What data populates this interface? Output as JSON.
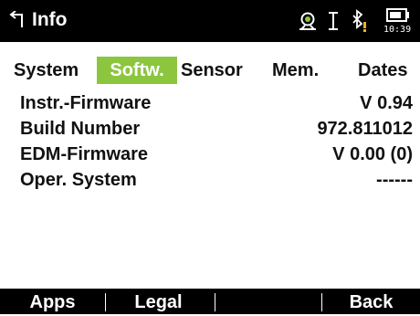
{
  "titlebar": {
    "title": "Info",
    "icons": [
      "back-arrow-icon",
      "target-camera-icon",
      "cursor-icon",
      "bluetooth-warning-icon",
      "battery-icon"
    ],
    "clock": "10:39",
    "accent_color": "#8cc63f",
    "warning_color": "#f2b21a"
  },
  "tabs": [
    {
      "label": "System",
      "active": false
    },
    {
      "label": "Softw.",
      "active": true
    },
    {
      "label": "Sensor",
      "active": false
    },
    {
      "label": "Mem.",
      "active": false
    },
    {
      "label": "Dates",
      "active": false
    }
  ],
  "rows": [
    {
      "label": "Instr.-Firmware",
      "value": "V 0.94"
    },
    {
      "label": "Build Number",
      "value": "972.811012"
    },
    {
      "label": "EDM-Firmware",
      "value": "V 0.00 (0)"
    },
    {
      "label": "Oper. System",
      "value": "------"
    }
  ],
  "softkeys": [
    {
      "label": "Apps"
    },
    {
      "label": "Legal"
    },
    {
      "label": ""
    },
    {
      "label": "Back"
    }
  ]
}
